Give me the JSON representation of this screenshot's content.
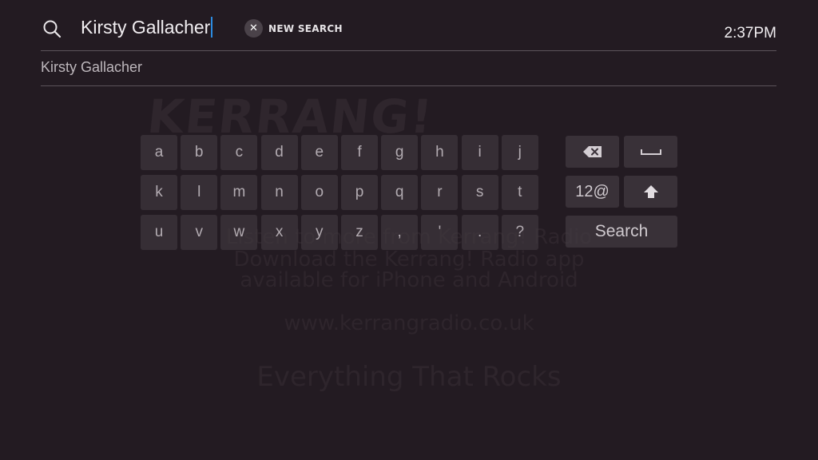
{
  "search": {
    "query": "Kirsty Gallacher",
    "new_search_label": "NEW SEARCH"
  },
  "clock": "2:37PM",
  "suggestions": [
    "Kirsty Gallacher"
  ],
  "keyboard": {
    "rows": [
      [
        "a",
        "b",
        "c",
        "d",
        "e",
        "f",
        "g",
        "h",
        "i",
        "j"
      ],
      [
        "k",
        "l",
        "m",
        "n",
        "o",
        "p",
        "q",
        "r",
        "s",
        "t"
      ],
      [
        "u",
        "v",
        "w",
        "x",
        "y",
        "z",
        ",",
        "'",
        ".",
        "?"
      ]
    ],
    "numbers_label": "12@",
    "search_label": "Search"
  },
  "background": {
    "logo": "KERRANG!",
    "line1": "Listen to more from Kerrang! Radio",
    "line2": "Download the Kerrang! Radio app",
    "line3": "available for iPhone and Android",
    "url": "www.kerrangradio.co.uk",
    "tagline": "Everything That Rocks"
  }
}
